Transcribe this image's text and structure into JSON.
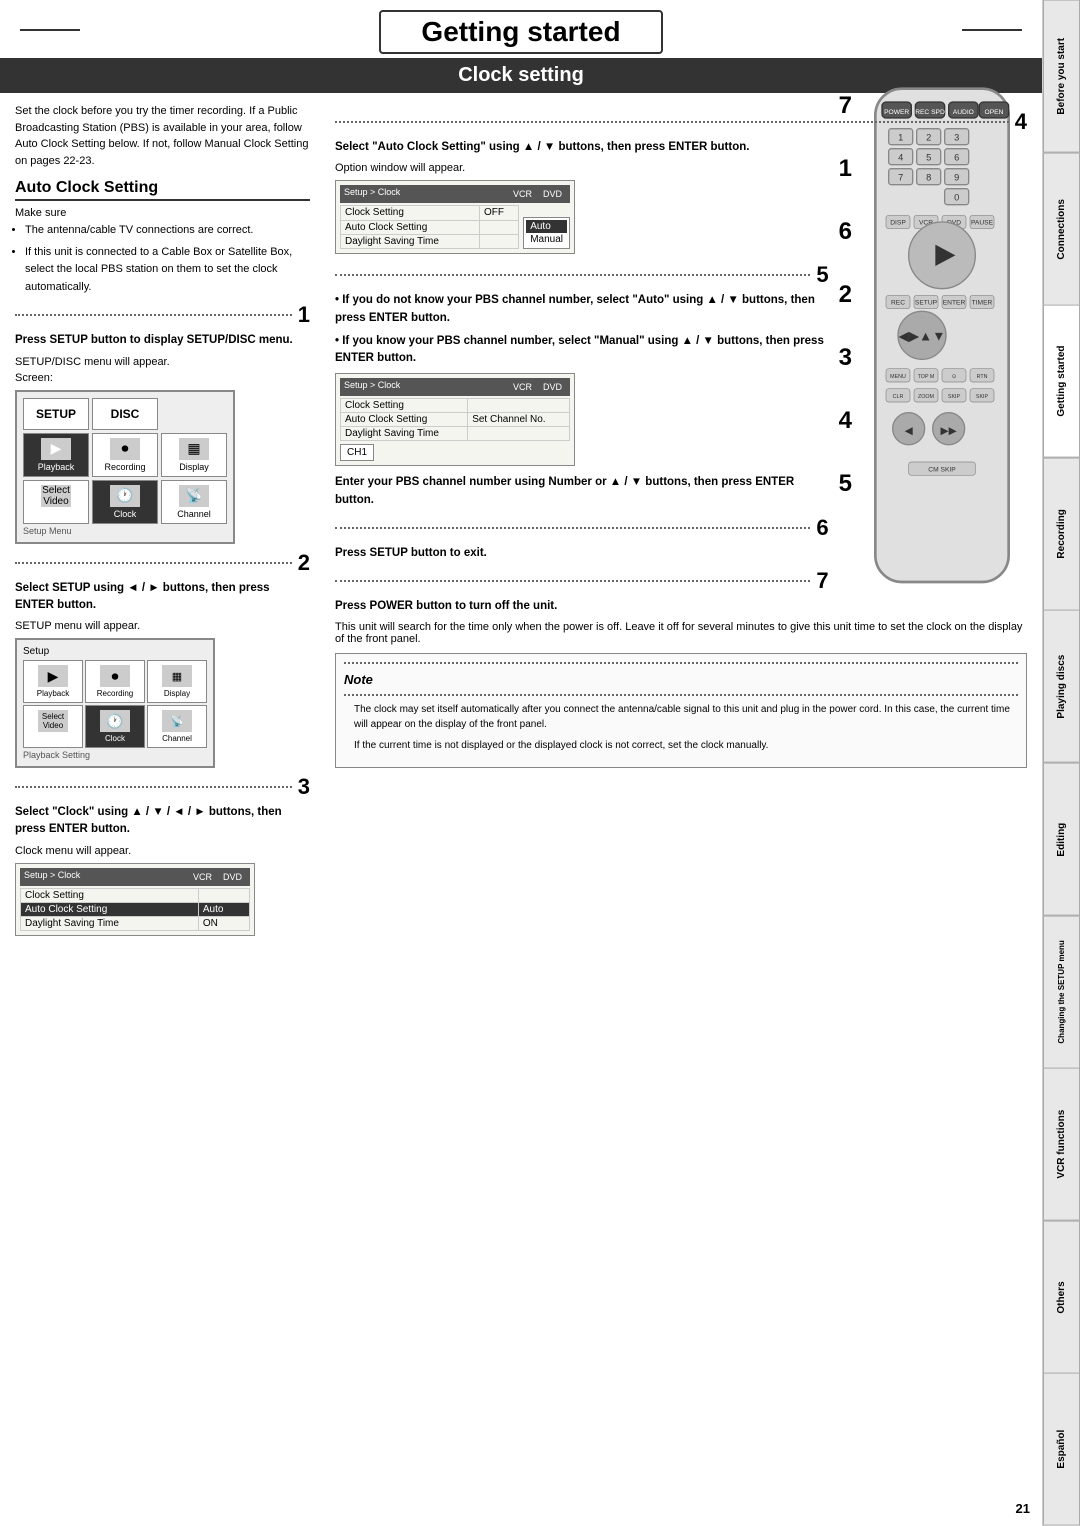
{
  "header": {
    "title": "Getting started",
    "section": "Clock setting"
  },
  "sidebar": {
    "tabs": [
      {
        "label": "Before you start",
        "active": false
      },
      {
        "label": "Connections",
        "active": false
      },
      {
        "label": "Getting started",
        "active": true
      },
      {
        "label": "Recording",
        "active": false
      },
      {
        "label": "Playing discs",
        "active": false
      },
      {
        "label": "Editing",
        "active": false
      },
      {
        "label": "Changing the SETUP menu",
        "active": false
      },
      {
        "label": "VCR functions",
        "active": false
      },
      {
        "label": "Others",
        "active": false
      },
      {
        "label": "Español",
        "active": false
      }
    ]
  },
  "auto_clock_section": {
    "heading": "Auto Clock Setting",
    "intro": "Set the clock before you try the timer recording. If a Public Broadcasting Station (PBS) is available in your area, follow Auto Clock Setting below. If not, follow Manual Clock Setting on pages 22-23.",
    "make_sure_label": "Make sure",
    "bullets": [
      "The antenna/cable TV connections are correct.",
      "If this unit is connected to a Cable Box or Satellite Box, select the local PBS station on them to set the clock automatically."
    ]
  },
  "steps": {
    "step1": {
      "number": "1",
      "instruction_bold": "Press SETUP button to display SETUP/DISC menu.",
      "result": "SETUP/DISC menu will appear.",
      "screen_label": "Screen:",
      "menu_label": "Setup Menu"
    },
    "step2": {
      "number": "2",
      "instruction_bold": "Select SETUP using ◄ / ► buttons, then press ENTER button.",
      "result": "SETUP menu will appear."
    },
    "step3": {
      "number": "3",
      "instruction_bold": "Select \"Clock\" using ▲ / ▼ / ◄ / ► buttons, then press ENTER button.",
      "result": "Clock menu will appear."
    },
    "step4": {
      "number": "4",
      "instruction_bold": "Select \"Auto Clock Setting\" using ▲ / ▼ buttons, then press ENTER button.",
      "result": "Option window will appear."
    },
    "step5": {
      "number": "5",
      "bullet1_bold": "If you do not know your PBS channel number, select \"Auto\" using ▲ / ▼ buttons, then press ENTER button.",
      "bullet2_bold": "If you know your PBS channel number, select \"Manual\" using ▲ / ▼ buttons, then press ENTER button."
    },
    "step5b": {
      "instruction_bold": "Enter your PBS channel number using Number or ▲ / ▼ buttons, then press ENTER button."
    },
    "step6": {
      "number": "6",
      "instruction_bold": "Press SETUP button to exit."
    },
    "step7": {
      "number": "7",
      "instruction_bold": "Press POWER button to turn off the unit.",
      "result": "This unit will search for the time only when the power is off. Leave it off for several minutes to give this unit time to set the clock on the display of the front panel."
    }
  },
  "right_step_nums": [
    "7",
    "1",
    "6",
    "2",
    "3",
    "4",
    "5"
  ],
  "note": {
    "title": "Note",
    "bullets": [
      "The clock may set itself automatically after you connect the antenna/cable signal to this unit and plug in the power cord. In this case, the current time will appear on the display of the front panel.",
      "If the current time is not displayed or the displayed clock is not correct, set the clock manually."
    ]
  },
  "screens": {
    "setup_clock_1": {
      "header_left": "Setup > Clock",
      "header_vcr": "VCR",
      "header_dvd": "DVD",
      "rows": [
        {
          "label": "Clock Setting",
          "value": ""
        },
        {
          "label": "Auto Clock Setting",
          "value": "Auto",
          "highlighted": true
        },
        {
          "label": "Daylight Saving Time",
          "value": "ON"
        }
      ]
    },
    "setup_clock_2": {
      "header_left": "Setup > Clock",
      "header_vcr": "VCR",
      "header_dvd": "DVD",
      "rows": [
        {
          "label": "Clock Setting",
          "value": "OFF"
        },
        {
          "label": "Auto Clock Setting",
          "value": "Auto",
          "highlighted": false
        },
        {
          "label": "Daylight Saving Time",
          "value": "Manual"
        }
      ],
      "popup": {
        "label": "",
        "value_auto": "Auto",
        "value_manual": "Manual"
      }
    },
    "setup_clock_3": {
      "header_left": "Setup > Clock",
      "header_vcr": "VCR",
      "header_dvd": "DVD",
      "rows": [
        {
          "label": "Clock Setting",
          "value": ""
        },
        {
          "label": "Auto Clock Setting",
          "value": "Set Channel No.",
          "highlighted": true
        },
        {
          "label": "Daylight Saving Time",
          "value": ""
        }
      ],
      "ch_box": "CH1"
    }
  },
  "page_number": "21",
  "colors": {
    "header_bg": "#333333",
    "header_text": "#ffffff",
    "section_border": "#333333",
    "sidebar_active": "#ffffff",
    "sidebar_inactive": "#e0e0e0"
  }
}
